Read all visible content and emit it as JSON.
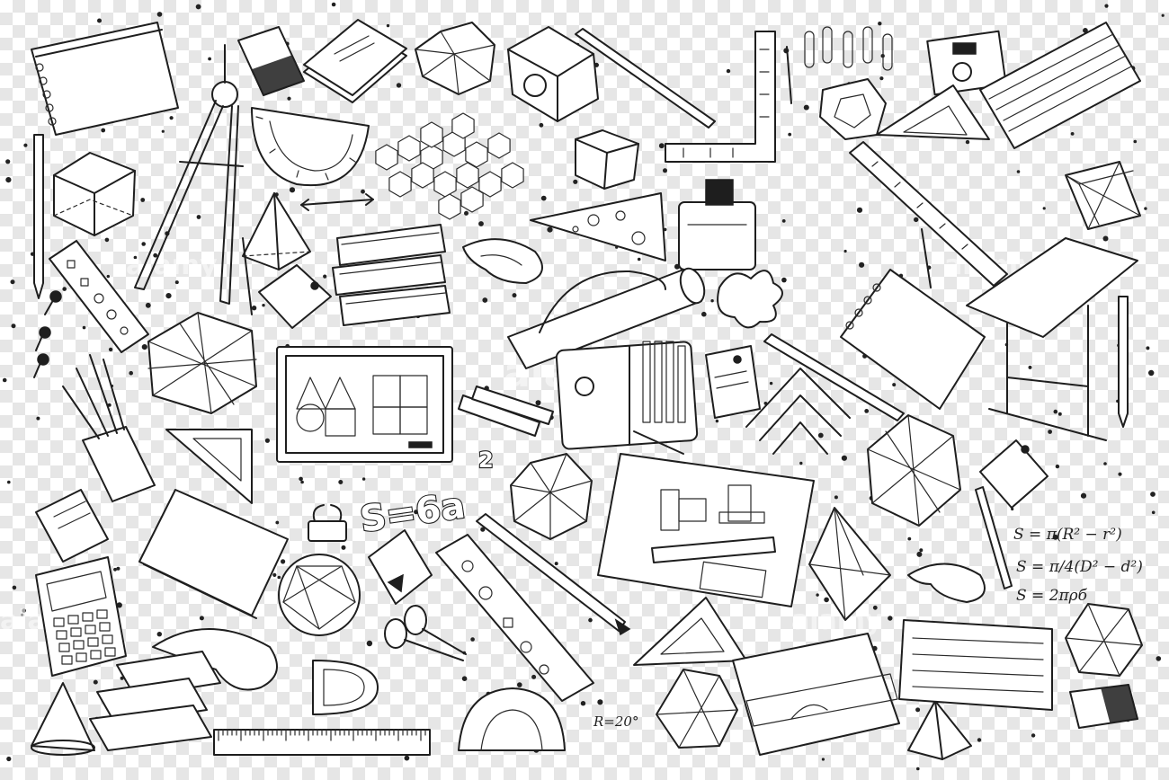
{
  "formulas": {
    "surface_area": "S=6a",
    "surface_area_exponent": "2",
    "ring_area": "S = π(R² − r²)",
    "ring_area_diameter": "S = π/4(D² − d²)",
    "lateral_area": "S = 2πρб",
    "radius": "R=20°"
  },
  "watermark": "alamy",
  "colors": {
    "ink": "#1e1e1e",
    "checker_light": "#ffffff",
    "checker_dark": "#e6e6e6"
  }
}
